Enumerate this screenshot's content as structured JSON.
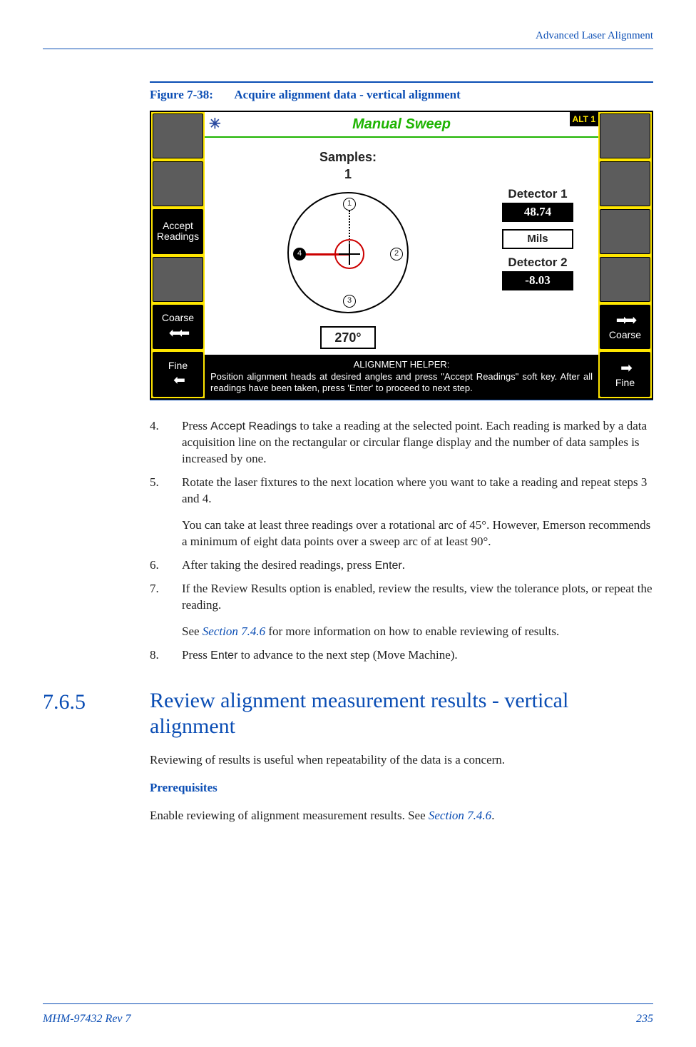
{
  "header": {
    "title": "Advanced Laser Alignment"
  },
  "figure": {
    "number": "Figure 7-38:",
    "title": "Acquire alignment data - vertical alignment"
  },
  "screen": {
    "title": "Manual Sweep",
    "alt": "ALT 1",
    "samples_label": "Samples:",
    "samples_value": "1",
    "angle": "270°",
    "detector1_label": "Detector 1",
    "detector1_value": "48.74",
    "units": "Mils",
    "detector2_label": "Detector 2",
    "detector2_value": "-8.03",
    "helper_title": "ALIGNMENT HELPER:",
    "helper_body": "Position alignment heads at desired angles and press \"Accept Readings\" soft key. After all readings have been taken, press 'Enter' to proceed to next step.",
    "left_keys": {
      "k1": "",
      "k2": "",
      "k3a": "Accept",
      "k3b": "Readings",
      "k4": "",
      "k5": "Coarse",
      "k6": "Fine"
    },
    "right_keys": {
      "k1": "",
      "k2": "",
      "k3": "",
      "k4": "",
      "k5": "Coarse",
      "k6": "Fine"
    }
  },
  "steps": {
    "s4": {
      "n": "4.",
      "p1a": "Press ",
      "p1b": "Accept Readings",
      "p1c": " to take a reading at the selected point. Each reading is marked by a data acquisition line on the rectangular or circular flange display and the number of data samples is increased by one."
    },
    "s5": {
      "n": "5.",
      "p1": "Rotate the laser fixtures to the next location where you want to take a reading and repeat steps 3 and 4.",
      "p2": "You can take at least three readings over a rotational arc of 45°. However, Emerson recommends a minimum of eight data points over a sweep arc of at least 90°."
    },
    "s6": {
      "n": "6.",
      "p1a": "After taking the desired readings, press ",
      "p1b": "Enter",
      "p1c": "."
    },
    "s7": {
      "n": "7.",
      "p1": "If the Review Results option is enabled, review the results, view the tolerance plots, or repeat the reading.",
      "p2a": "See ",
      "p2b": "Section 7.4.6",
      "p2c": " for more information on how to enable reviewing of results."
    },
    "s8": {
      "n": "8.",
      "p1a": "Press ",
      "p1b": "Enter",
      "p1c": " to advance to the next step (Move Machine)."
    }
  },
  "section": {
    "num": "7.6.5",
    "title": "Review alignment measurement results - vertical alignment",
    "intro": "Reviewing of results is useful when repeatability of the data is a concern.",
    "prereq_h": "Prerequisites",
    "prereq_a": "Enable reviewing of alignment measurement results. See ",
    "prereq_b": "Section 7.4.6",
    "prereq_c": "."
  },
  "footer": {
    "left": "MHM-97432 Rev 7",
    "right": "235"
  }
}
